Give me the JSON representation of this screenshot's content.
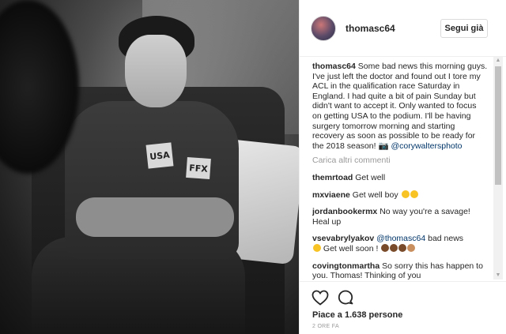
{
  "post": {
    "username": "thomasc64",
    "follow_label": "Segui già"
  },
  "caption": {
    "user": "thomasc64",
    "text": "Some bad news this morning guys. I've just left the doctor and found out I tore my ACL in the qualification race Saturday in England. I had quite a bit of pain Sunday but didn't want to accept it. Only wanted to focus on getting USA to the podium. I'll be having surgery tomorrow morning and starting recovery as soon as possible to be ready for the 2018 season! ",
    "camera_emoji": "📷",
    "mention": "@corywaltersphoto"
  },
  "load_more_label": "Carica altri commenti",
  "comments": [
    {
      "user": "themrtoad",
      "text": "Get well"
    },
    {
      "user": "mxviaene",
      "text": "Get well boy "
    },
    {
      "user": "jordanbookermx",
      "text": "No way you're a savage! Heal up"
    },
    {
      "user": "vsevabrylyakov",
      "mention": "@thomasc64",
      "text": " bad news",
      "text2": " Get well soon ! "
    },
    {
      "user": "covingtonmartha",
      "text": "So sorry this has happen to you. Thomas! Thinking of you "
    }
  ],
  "likes": "Piace a 1.638 persone",
  "timestamp": "2 ORE FA",
  "photo": {
    "patch_left": "USA",
    "patch_right": "FFX"
  },
  "icons": {
    "like": "heart-icon",
    "comment": "comment-bubble-icon",
    "scroll_up": "scroll-up-arrow-icon",
    "scroll_down": "scroll-down-arrow-icon"
  },
  "colors": {
    "link": "#003569",
    "muted": "#999999",
    "border": "#dbdbdb"
  }
}
